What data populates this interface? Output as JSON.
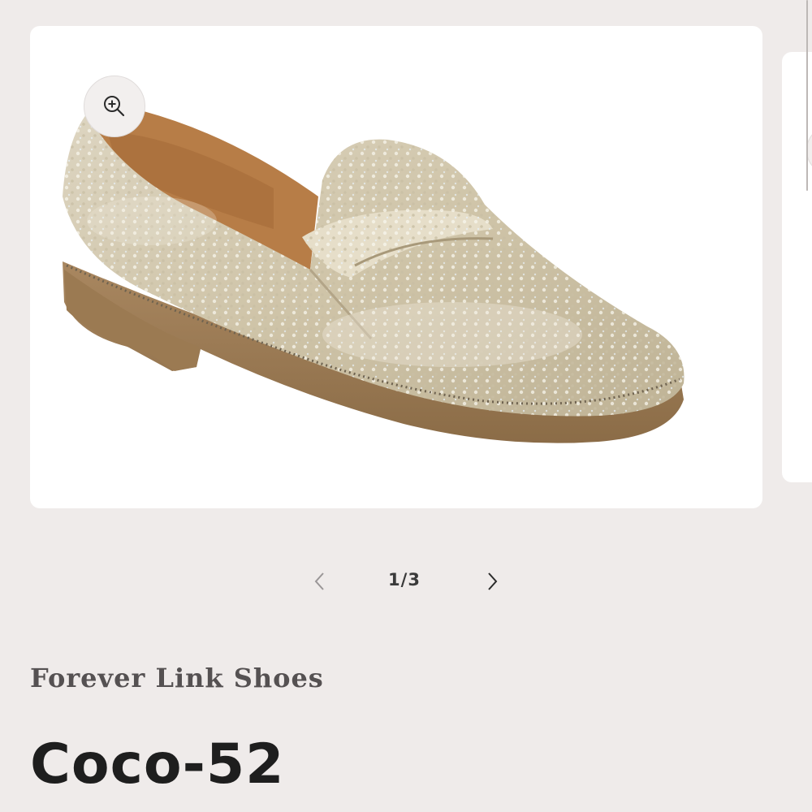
{
  "product": {
    "vendor": "Forever Link Shoes",
    "title": "Coco-52"
  },
  "gallery": {
    "counter": "1/3",
    "zoom_icon": "zoom-in-icon",
    "prev_icon": "chevron-left-icon",
    "next_icon": "chevron-right-icon"
  },
  "colors": {
    "background": "#efebea",
    "card": "#ffffff",
    "text_primary": "#1e1e1e",
    "text_vendor": "#555152",
    "shoe_upper": "#d8cfb8",
    "shoe_sole": "#9c7c55",
    "shoe_lining": "#b77d47"
  }
}
